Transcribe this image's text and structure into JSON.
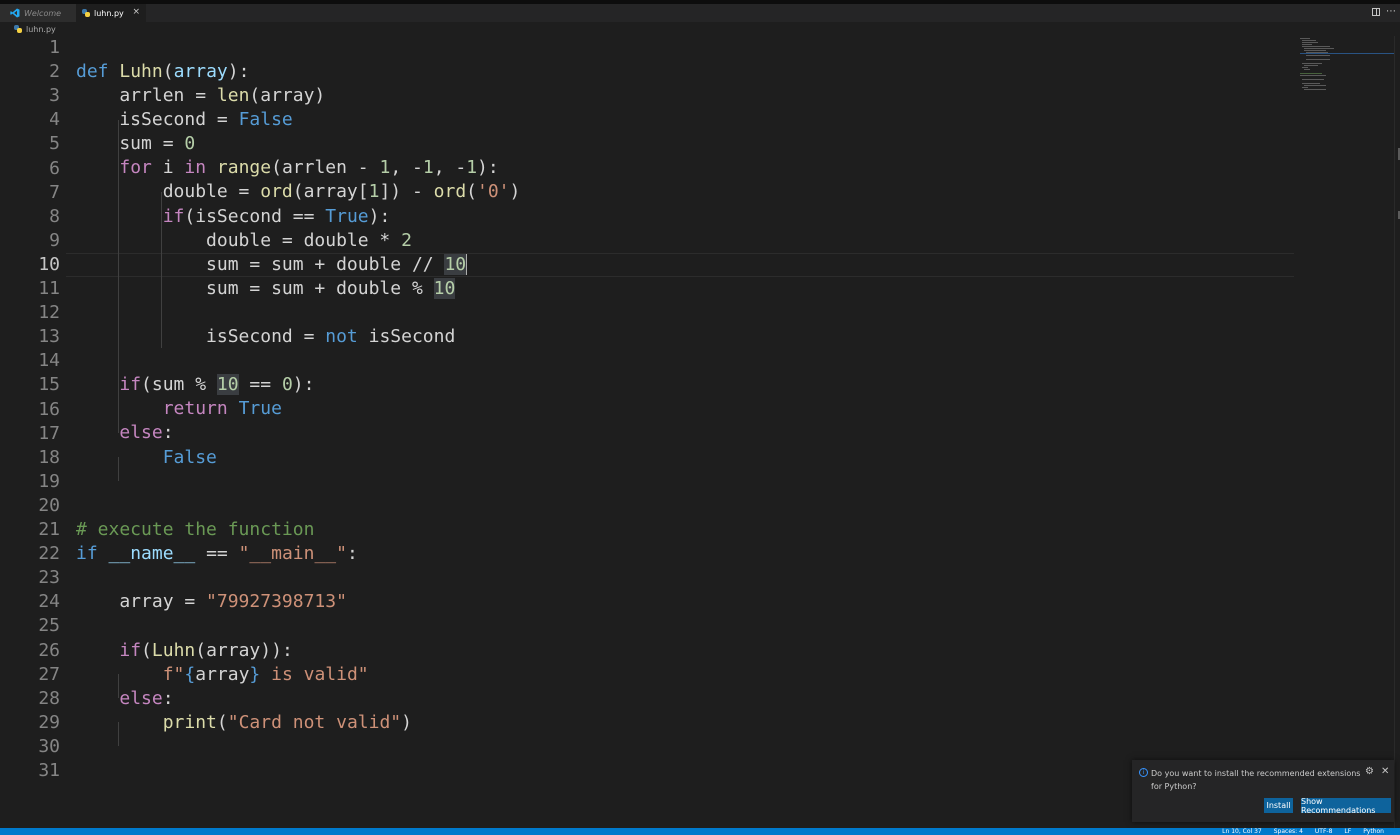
{
  "tabs": [
    {
      "label": "Welcome",
      "icon": "vscode-icon"
    },
    {
      "label": "luhn.py",
      "icon": "python-file-icon",
      "close": "×"
    }
  ],
  "breadcrumb": {
    "file": "luhn.py"
  },
  "editor": {
    "active_line": 10,
    "line_numbers": [
      "1",
      "2",
      "3",
      "4",
      "5",
      "6",
      "7",
      "8",
      "9",
      "10",
      "11",
      "12",
      "13",
      "14",
      "15",
      "16",
      "17",
      "18",
      "19",
      "20",
      "21",
      "22",
      "23",
      "24",
      "25",
      "26",
      "27",
      "28",
      "29",
      "30",
      "31"
    ]
  },
  "notification": {
    "message": "Do you want to install the recommended extensions for Python?",
    "install_label": "Install",
    "show_recommendations_label": "Show Recommendations"
  },
  "statusbar": {
    "position": "Ln 10, Col 37",
    "spaces": "Spaces: 4",
    "encoding": "UTF-8",
    "eol": "LF",
    "language": "Python"
  },
  "colors": {
    "accent": "#007acc",
    "keyword": "#569cd6",
    "control": "#c586c0",
    "function": "#dcdcaa",
    "number": "#b5cea8",
    "string": "#ce9178",
    "comment": "#6a9955"
  }
}
